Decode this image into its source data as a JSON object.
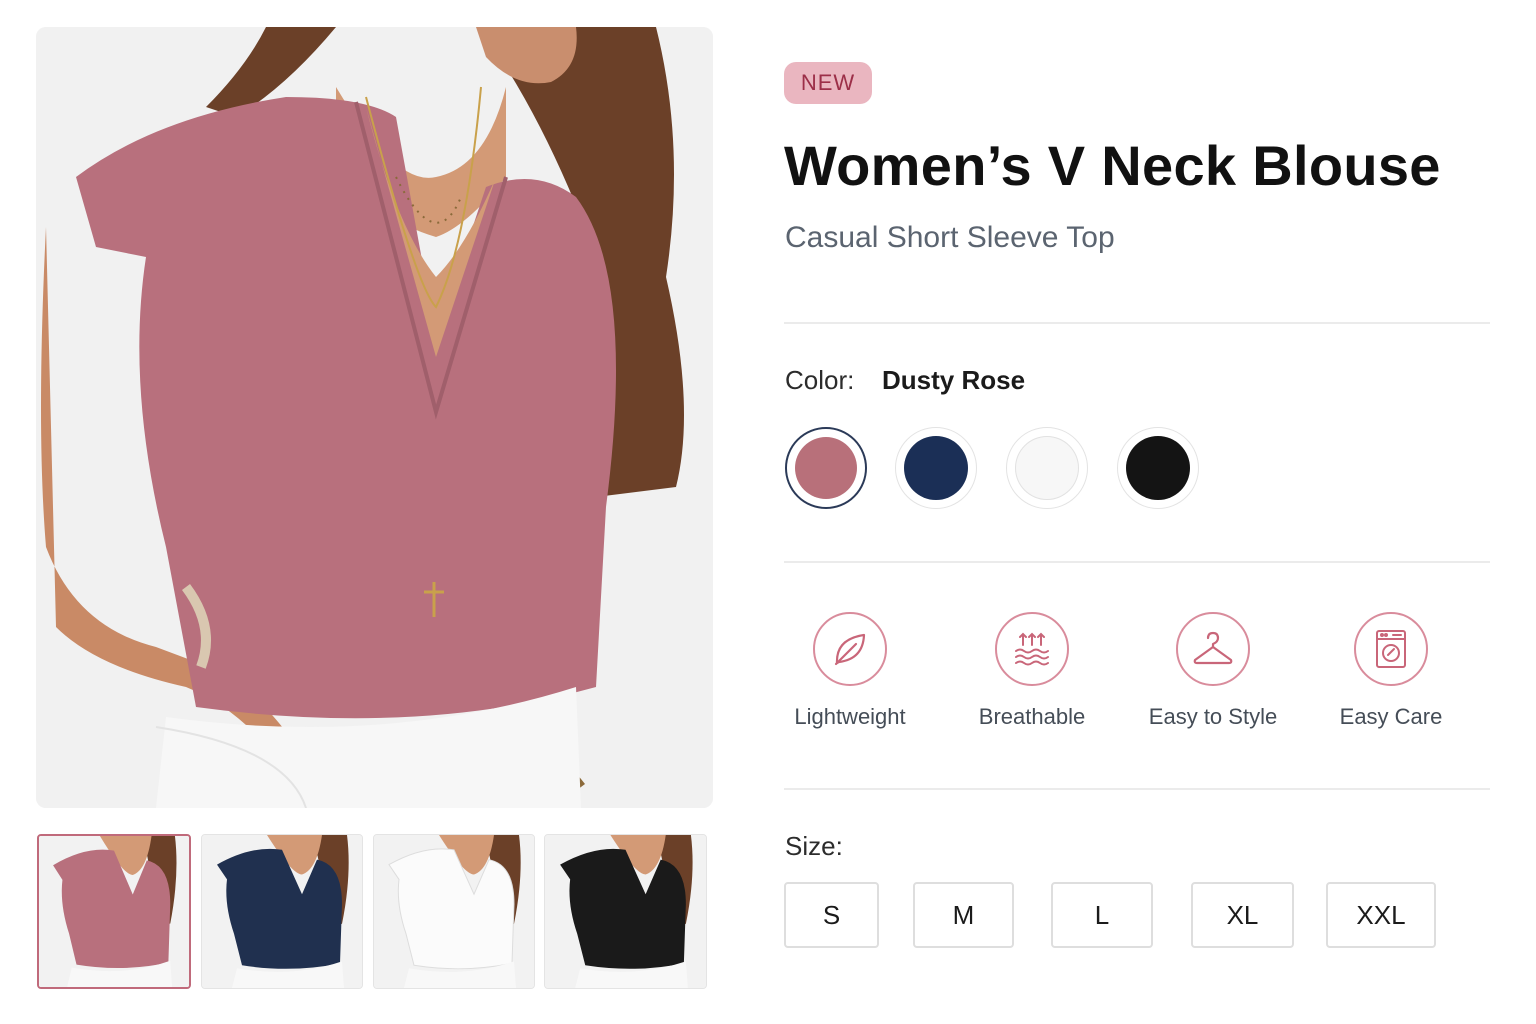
{
  "product": {
    "badge": "NEW",
    "title": "Women’s V Neck Blouse",
    "subtitle": "Casual Short Sleeve Top"
  },
  "gallery": {
    "main_image": "model-wearing-dusty-rose-blouse",
    "thumbnails": [
      {
        "name": "Dusty Rose",
        "color": "#b8707d",
        "selected": true
      },
      {
        "name": "Navy",
        "color": "#20304f",
        "selected": false
      },
      {
        "name": "White",
        "color": "#f4f4f4",
        "selected": false
      },
      {
        "name": "Black",
        "color": "#1a1a1a",
        "selected": false
      }
    ]
  },
  "color_selector": {
    "label": "Color:",
    "selected_value": "Dusty Rose",
    "swatches": [
      {
        "name": "Dusty Rose",
        "color": "#b8707a",
        "selected": true
      },
      {
        "name": "Navy",
        "color": "#1b2f56",
        "selected": false
      },
      {
        "name": "White",
        "color": "#f7f7f7",
        "selected": false
      },
      {
        "name": "Black",
        "color": "#141414",
        "selected": false
      }
    ]
  },
  "features": [
    {
      "label": "Lightweight",
      "icon": "leaf-icon"
    },
    {
      "label": "Breathable",
      "icon": "air-waves-icon"
    },
    {
      "label": "Easy to Style",
      "icon": "hanger-icon"
    },
    {
      "label": "Easy Care",
      "icon": "washing-machine-icon"
    }
  ],
  "size_selector": {
    "label": "Size:",
    "options": [
      "S",
      "M",
      "L",
      "XL",
      "XXL"
    ]
  },
  "colors": {
    "accent": "#c06a7b",
    "badge_bg": "#eab6c0",
    "badge_text": "#9c2f48",
    "icon_stroke": "#c96679"
  }
}
